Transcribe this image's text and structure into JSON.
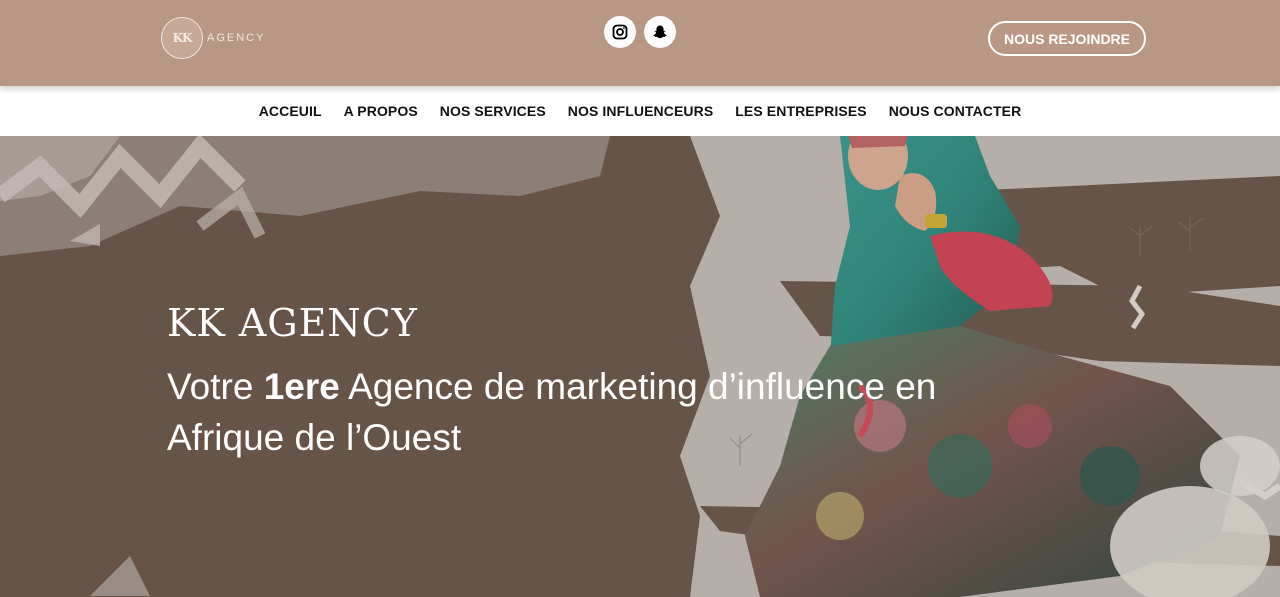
{
  "header": {
    "logo_initials": "KK",
    "logo_word": "AGENCY",
    "join_label": "NOUS REJOINDRE",
    "socials": [
      {
        "icon": "instagram-icon"
      },
      {
        "icon": "snapchat-icon"
      }
    ]
  },
  "nav": {
    "items": [
      {
        "label": "ACCEUIL"
      },
      {
        "label": "A PROPOS"
      },
      {
        "label": "NOS SERVICES"
      },
      {
        "label": "NOS INFLUENCEURS"
      },
      {
        "label": "LES ENTREPRISES"
      },
      {
        "label": "NOUS CONTACTER"
      }
    ]
  },
  "hero": {
    "brand": "KK AGENCY",
    "tagline_prefix": "Votre ",
    "tagline_bold": "1ere",
    "tagline_suffix": " Agence de marketing d’influence en Afrique de l’Ouest"
  },
  "colors": {
    "topbar": "#b89785",
    "hero_bg": "#6e5a4e",
    "nav_bg": "#ffffff",
    "text_light": "#ffffff"
  }
}
